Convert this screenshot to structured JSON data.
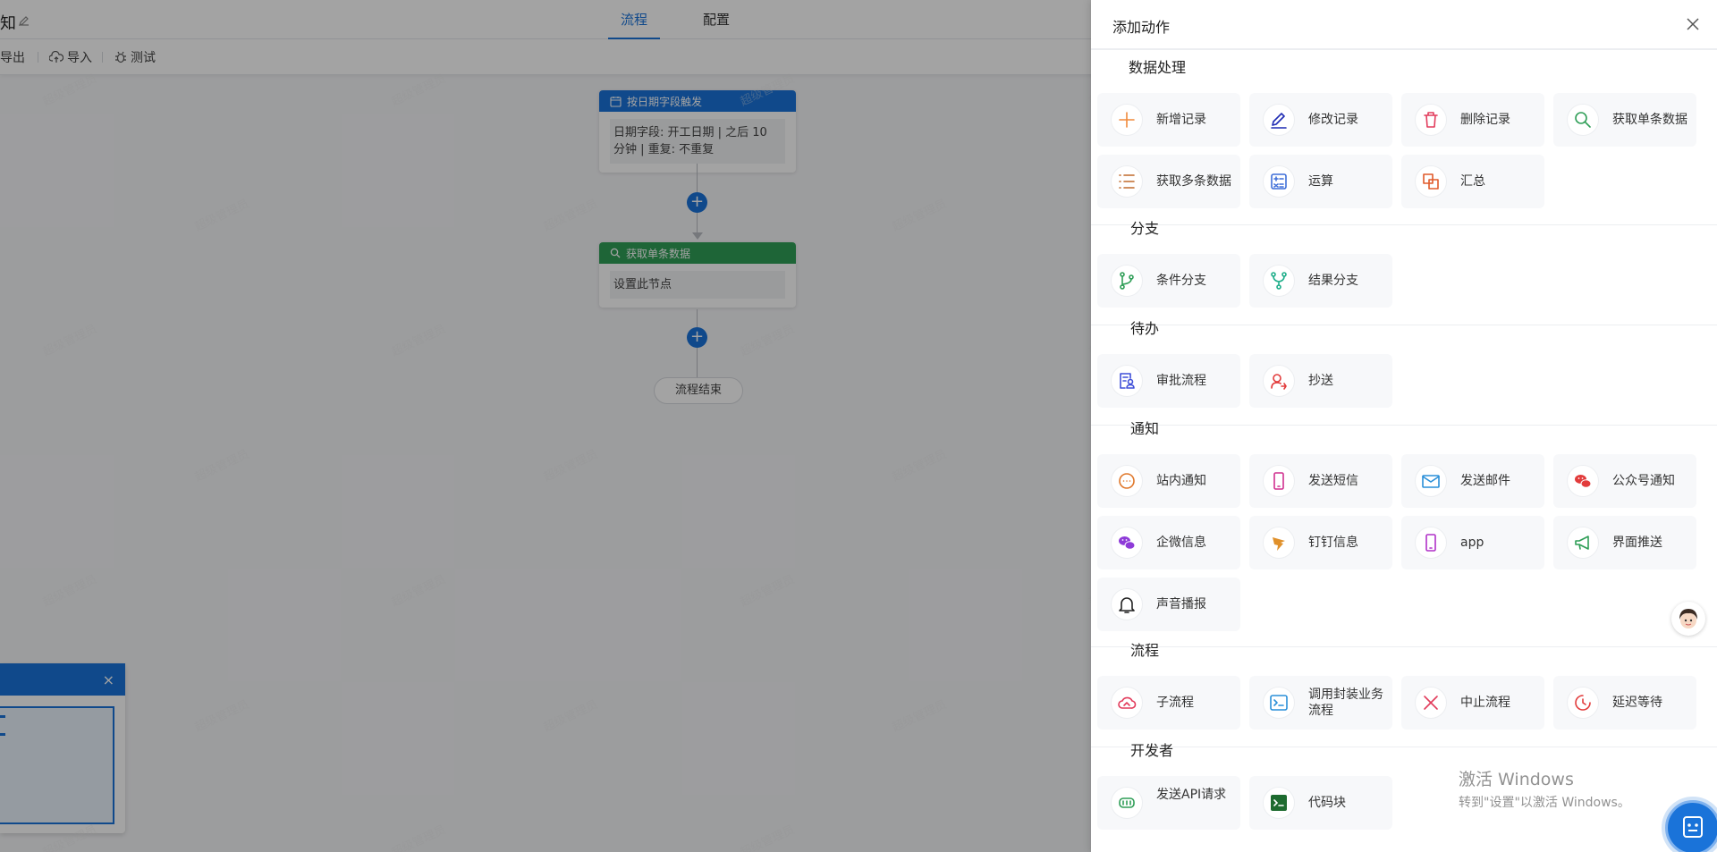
{
  "app": {
    "title": "知"
  },
  "tabs": [
    {
      "label": "流程",
      "active": true
    },
    {
      "label": "配置",
      "active": false
    }
  ],
  "toolbar": {
    "export": "导出",
    "import": "导入",
    "test": "测试"
  },
  "flow": {
    "trigger": {
      "header": "按日期字段触发",
      "body": "日期字段: 开工日期 | 之后 10 分钟 | 重复: 不重复",
      "color": "#1a73d9"
    },
    "step": {
      "header": "获取单条数据",
      "body": "设置此节点",
      "color": "#2f9e57"
    },
    "add_symbol": "+",
    "end": "流程结束"
  },
  "minimap": {
    "close": "×"
  },
  "watermark": "超级管理员",
  "drawer": {
    "title": "添加动作",
    "sections": [
      {
        "title": "数据处理",
        "items": [
          {
            "label": "新增记录",
            "icon": "plus-icon",
            "color": "#f08a3c"
          },
          {
            "label": "修改记录",
            "icon": "pen-icon",
            "color": "#1f2bb3"
          },
          {
            "label": "删除记录",
            "icon": "trash-icon",
            "color": "#e23b5b"
          },
          {
            "label": "获取单条数据",
            "icon": "search-icon",
            "color": "#2f9e57"
          },
          {
            "label": "获取多条数据",
            "icon": "list-icon",
            "color": "#c06a2c"
          },
          {
            "label": "运算",
            "icon": "calculator-icon",
            "color": "#3f6fd8"
          },
          {
            "label": "汇总",
            "icon": "merge-icon",
            "color": "#e05a2a"
          }
        ]
      },
      {
        "title": "分支",
        "items": [
          {
            "label": "条件分支",
            "icon": "branch-icon",
            "color": "#2f9e57"
          },
          {
            "label": "结果分支",
            "icon": "fork-icon",
            "color": "#1fae8a"
          }
        ]
      },
      {
        "title": "待办",
        "items": [
          {
            "label": "审批流程",
            "icon": "approval-icon",
            "color": "#3f4fd8"
          },
          {
            "label": "抄送",
            "icon": "cc-icon",
            "color": "#e23b3b"
          }
        ]
      },
      {
        "title": "通知",
        "items": [
          {
            "label": "站内通知",
            "icon": "chat-bubble-icon",
            "color": "#e0772a"
          },
          {
            "label": "发送短信",
            "icon": "phone-icon",
            "color": "#d0308f"
          },
          {
            "label": "发送邮件",
            "icon": "mail-icon",
            "color": "#2a8fd8"
          },
          {
            "label": "公众号通知",
            "icon": "wechat-icon",
            "color": "#e23b3b"
          },
          {
            "label": "企微信息",
            "icon": "wecom-icon",
            "color": "#8e3bd8"
          },
          {
            "label": "钉钉信息",
            "icon": "dingtalk-icon",
            "color": "#e0902a"
          },
          {
            "label": "app",
            "icon": "mobile-icon",
            "color": "#b030c8"
          },
          {
            "label": "界面推送",
            "icon": "megaphone-icon",
            "color": "#2f9e57"
          },
          {
            "label": "声音播报",
            "icon": "bell-icon",
            "color": "#222222"
          }
        ]
      },
      {
        "title": "流程",
        "items": [
          {
            "label": "子流程",
            "icon": "cloud-icon",
            "color": "#e23b5b"
          },
          {
            "label": "调用封装业务流程",
            "icon": "terminal-icon",
            "color": "#2a8fd8"
          },
          {
            "label": "中止流程",
            "icon": "x-icon",
            "color": "#e23b5b"
          },
          {
            "label": "延迟等待",
            "icon": "clock-icon",
            "color": "#e23b3b"
          }
        ]
      },
      {
        "title": "开发者",
        "items": [
          {
            "label": "发送API请求",
            "icon": "api-icon",
            "color": "#2f9e57"
          },
          {
            "label": "代码块",
            "icon": "code-block-icon",
            "color": "#1e6b2f"
          }
        ]
      }
    ]
  },
  "system": {
    "activate_title": "激活 Windows",
    "activate_hint": "转到\"设置\"以激活 Windows。"
  }
}
